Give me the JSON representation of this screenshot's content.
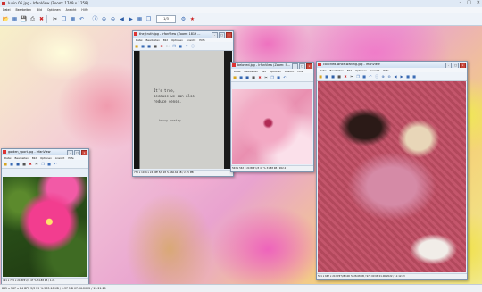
{
  "main": {
    "title": "lupin 06.jpg - IrfanView (Zoom: 1749 x 1258)",
    "menu": [
      "Datei",
      "Bearbeiten",
      "Bild",
      "Optionen",
      "Ansicht",
      "Hilfe"
    ],
    "page_box": "1/3",
    "status": "885 x 567 x 24 BPP    3/3   29 %    503.10 KB / 1.37 MB    07.06.2022 / 13:21:20"
  },
  "windows": [
    {
      "id": "golden",
      "title": "golden_sport.jpg - IrfanView",
      "menu": [
        "Datei",
        "Bearbeiten",
        "Bild",
        "Optionen",
        "Ansicht",
        "Hilfe"
      ],
      "status": "491 x 715 x 24 BPP   2/3   47 %   74.88 KB / 1.21"
    },
    {
      "id": "truth",
      "title": "the_truth.jpg - IrfanView (Zoom: 1819 ...",
      "menu": [
        "Datei",
        "Bearbeiten",
        "Bild",
        "Optionen",
        "Ansicht",
        "Hilfe"
      ],
      "quote_lines": [
        "It's true,",
        "because we can also",
        "reduce sense."
      ],
      "signature": "kerry poetry",
      "status": "770 x 1036 x 24 BPP   5/6   28 %   160.62 KB / 2.75 MB"
    },
    {
      "id": "beloved",
      "title": "beloved.jpg - IrfanView (Zoom: 5...",
      "menu": [
        "Datei",
        "Bearbeiten",
        "Bild",
        "Optionen",
        "Ansicht",
        "Hilfe"
      ],
      "status": "563 x 563 x 24 BPP   1/3   47 %   31.88 KB / 902.2"
    },
    {
      "id": "couched",
      "title": "couched-while-waiting.jpg - IrfanView",
      "menu": [
        "Datei",
        "Bearbeiten",
        "Bild",
        "Optionen",
        "Ansicht",
        "Hilfe"
      ],
      "status": "501 x 667 x 24 BPP   5/8   100 %   28.68 KB / 977.09 KB   01.06.2022 / 11:12:23"
    }
  ],
  "colors": {
    "window_border": "#7f94ad",
    "close_red": "#c9473c",
    "toolbar_bg": "#eef3f9"
  },
  "icons": [
    "open-icon",
    "save-icon",
    "print-icon",
    "close-icon",
    "cut-icon",
    "copy-icon",
    "paste-icon",
    "undo-icon",
    "info-icon",
    "zoom-in-icon",
    "zoom-out-icon",
    "prev-icon",
    "next-icon",
    "settings-icon"
  ]
}
